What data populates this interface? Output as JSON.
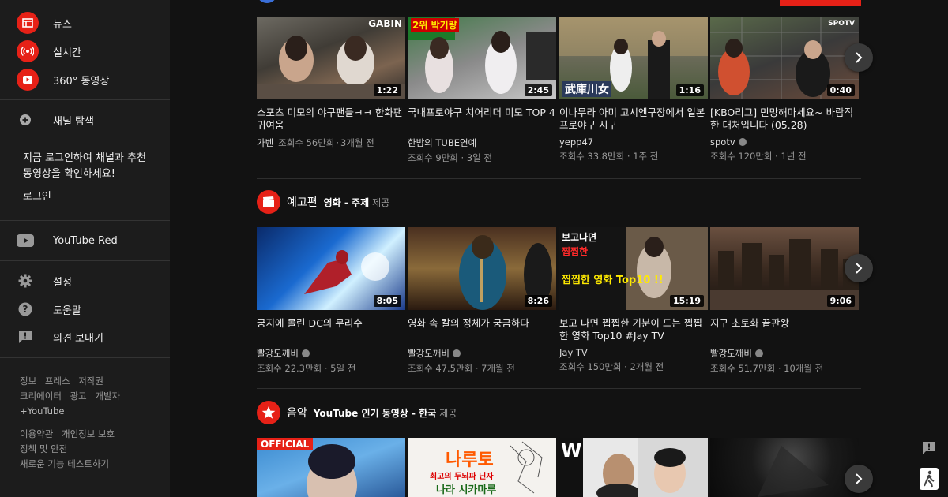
{
  "sidebar": {
    "items_top": [
      {
        "label": "뉴스",
        "icon": "news-icon"
      },
      {
        "label": "실시간",
        "icon": "live-icon"
      },
      {
        "label": "360° 동영상",
        "icon": "360-video-icon"
      }
    ],
    "browse_channels": "채널 탐색",
    "login_prompt": "지금 로그인하여 채널과 추천 동영상을 확인하세요!",
    "login": "로그인",
    "youtube_red": "YouTube Red",
    "settings": "설정",
    "help": "도움말",
    "feedback": "의견 보내기",
    "footer1": [
      "정보",
      "프레스",
      "저작권",
      "크리에이터",
      "광고",
      "개발자",
      "+YouTube"
    ],
    "footer2": [
      "이용약관",
      "개인정보 보호",
      "정책 및 안전",
      "새로운 기능 테스트하기"
    ]
  },
  "shelves": [
    {
      "title": "",
      "videos": [
        {
          "title": "스포츠 미모의 야구팬들ㅋㅋ 한화팬 귀여움",
          "channel": "가벤",
          "verified": false,
          "views": "조회수 56만회",
          "age": "3개월 전",
          "duration": "1:22",
          "thumb_text": "GABIN",
          "inline_meta": true
        },
        {
          "title": "국내프로야구 치어리더 미모 TOP 4",
          "channel": "한밤의 TUBE연예",
          "verified": false,
          "views": "조회수 9만회",
          "age": "3일 전",
          "duration": "2:45",
          "thumb_text": "2위 박기량",
          "inline_meta": false
        },
        {
          "title": "이나무라 아미 고시엔구장에서 일본 프로야구 시구",
          "channel": "yepp47",
          "verified": false,
          "views": "조회수 33.8만회",
          "age": "1주 전",
          "duration": "1:16",
          "thumb_text": "武庫川女",
          "inline_meta": false
        },
        {
          "title": "[KBO리그] 민망해마세요~ 바람직한 대처입니다 (05.28)",
          "channel": "spotv",
          "verified": true,
          "views": "조회수 120만회",
          "age": "1년 전",
          "duration": "0:40",
          "thumb_text": "SPOTV",
          "inline_meta": false
        }
      ]
    },
    {
      "title": "예고편",
      "subtitle": "영화 - 주제",
      "provider": "제공",
      "videos": [
        {
          "title": "궁지에 몰린 DC의 무리수",
          "channel": "빨강도깨비",
          "verified": true,
          "views": "조회수 22.3만회",
          "age": "5일 전",
          "duration": "8:05"
        },
        {
          "title": "영화 속 칼의 정체가 궁금하다",
          "channel": "빨강도깨비",
          "verified": true,
          "views": "조회수 47.5만회",
          "age": "7개월 전",
          "duration": "8:26"
        },
        {
          "title": "보고 나면 찝찝한 기분이 드는 찝찝한 영화 Top10 #Jay TV",
          "channel": "Jay TV",
          "verified": false,
          "views": "조회수 150만회",
          "age": "2개월 전",
          "duration": "15:19",
          "thumb_text1": "보고나면",
          "thumb_text2": "찝찝한",
          "thumb_text3": "찝찝한 영화 Top10 !!"
        },
        {
          "title": "지구 초토화 끝판왕",
          "channel": "빨강도깨비",
          "verified": true,
          "views": "조회수 51.7만회",
          "age": "10개월 전",
          "duration": "9:06"
        }
      ]
    },
    {
      "title": "음악",
      "subtitle": "YouTube 인기 동영상 - 한국",
      "provider": "제공",
      "videos": [
        {
          "thumb_text": "OFFICIAL"
        },
        {
          "thumb_text1": "나루토",
          "thumb_text2": "최고의 두뇌파 닌자",
          "thumb_text3": "나라 시카마루"
        },
        {
          "thumb_text": "W"
        },
        {
          "thumb_text": ""
        }
      ]
    }
  ],
  "separator": "·",
  "colors": {
    "accent": "#e62117",
    "bg": "#121212",
    "sidebar": "#1c1c1c"
  }
}
